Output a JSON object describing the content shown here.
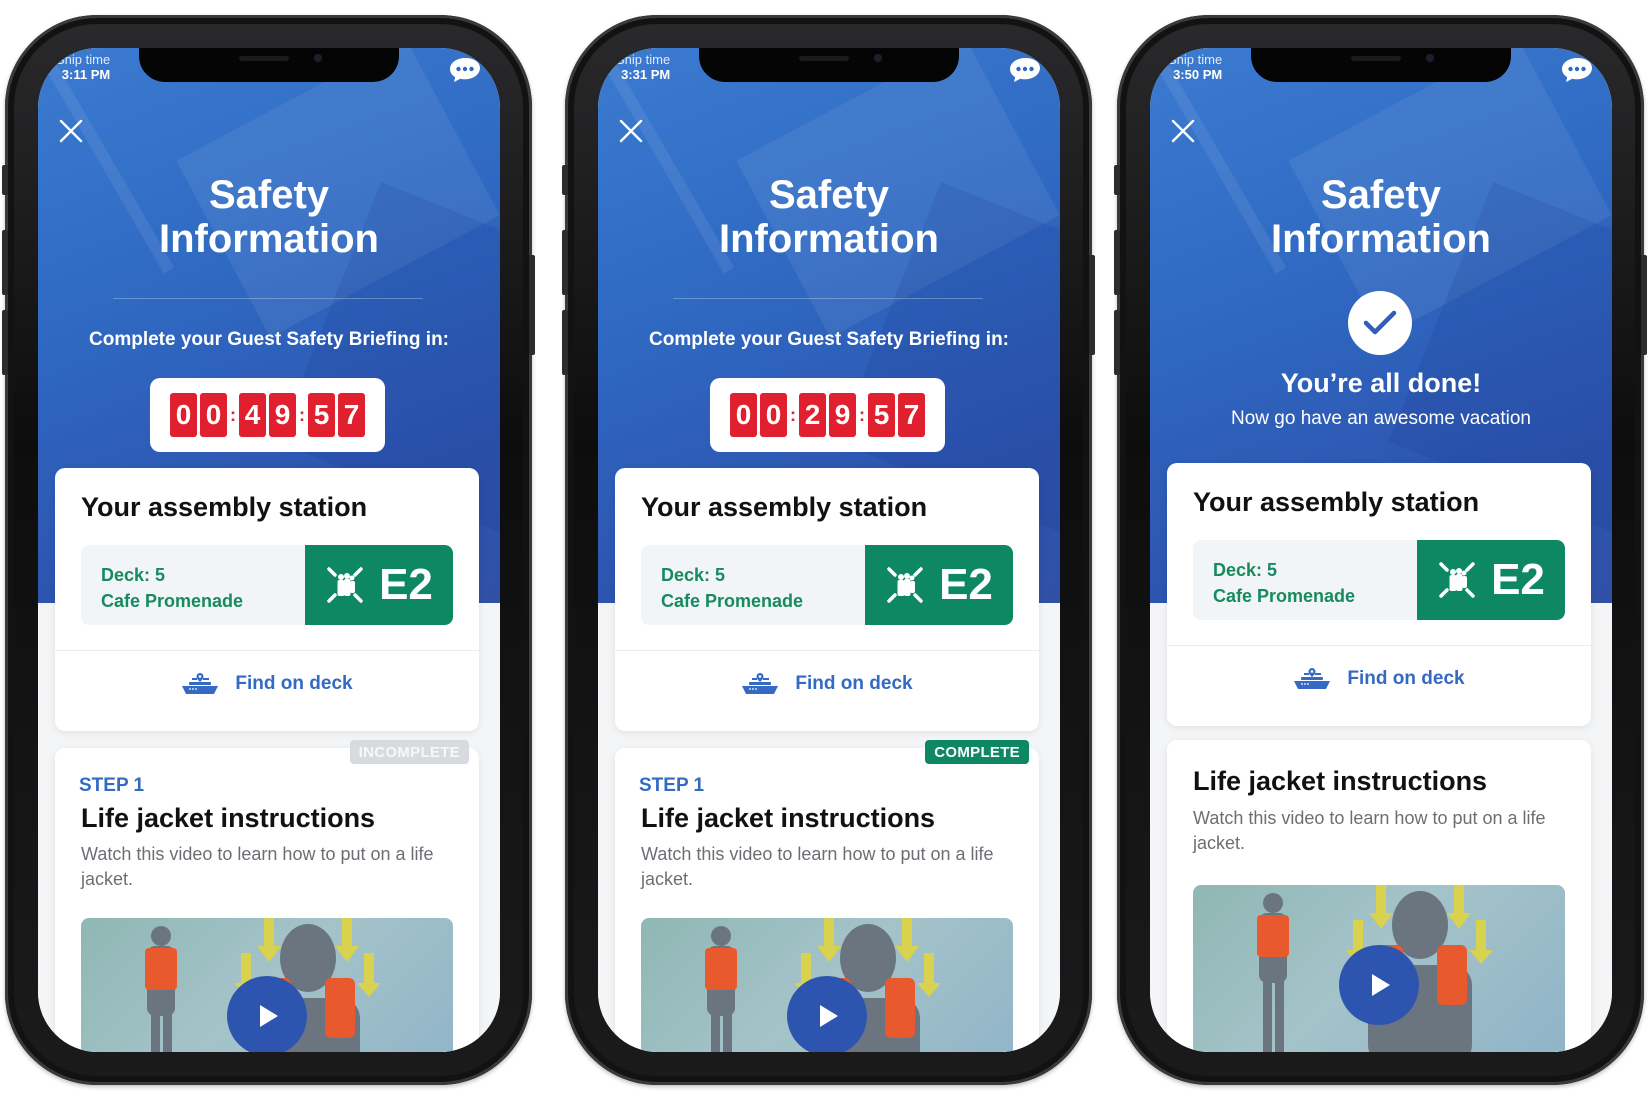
{
  "phones": [
    {
      "ship_time_label": "Ship time",
      "ship_time": "3:11 PM",
      "title_line1": "Safety",
      "title_line2": "Information",
      "countdown_label": "Complete your Guest Safety Briefing in:",
      "countdown_digits": [
        "0",
        "0",
        "4",
        "9",
        "5",
        "7"
      ],
      "countdown_separator": ":",
      "station": {
        "heading": "Your assembly station",
        "deck": "Deck: 5",
        "location": "Cafe Promenade",
        "code": "E2",
        "find_label": "Find on deck"
      },
      "step": {
        "status": "INCOMPLETE",
        "label": "STEP 1",
        "title": "Life jacket instructions",
        "description": "Watch this video to learn how to put on a life jacket."
      }
    },
    {
      "ship_time_label": "Ship time",
      "ship_time": "3:31 PM",
      "title_line1": "Safety",
      "title_line2": "Information",
      "countdown_label": "Complete your Guest Safety Briefing in:",
      "countdown_digits": [
        "0",
        "0",
        "2",
        "9",
        "5",
        "7"
      ],
      "countdown_separator": ":",
      "station": {
        "heading": "Your assembly station",
        "deck": "Deck: 5",
        "location": "Cafe Promenade",
        "code": "E2",
        "find_label": "Find on deck"
      },
      "step": {
        "status": "COMPLETE",
        "label": "STEP 1",
        "title": "Life jacket instructions",
        "description": "Watch this video to learn how to put on a life jacket."
      }
    },
    {
      "ship_time_label": "Ship time",
      "ship_time": "3:50 PM",
      "title_line1": "Safety",
      "title_line2": "Information",
      "done_title": "You’re all done!",
      "done_subtitle": "Now go have an awesome vacation",
      "station": {
        "heading": "Your assembly station",
        "deck": "Deck: 5",
        "location": "Cafe Promenade",
        "code": "E2",
        "find_label": "Find on deck"
      },
      "step": {
        "title": "Life jacket instructions",
        "description": "Watch this video to learn how to put on a life jacket."
      }
    }
  ],
  "icons": {
    "close": "close-icon",
    "chat": "chat-bubble-icon",
    "assembly": "assembly-station-icon",
    "ship": "ship-location-icon",
    "play": "play-icon",
    "check": "checkmark-icon"
  },
  "colors": {
    "brand_blue": "#2f69c2",
    "countdown_red": "#e0202e",
    "station_green": "#0d8862",
    "link_blue": "#3469c4",
    "incomplete_gray": "#d7dbe0"
  }
}
